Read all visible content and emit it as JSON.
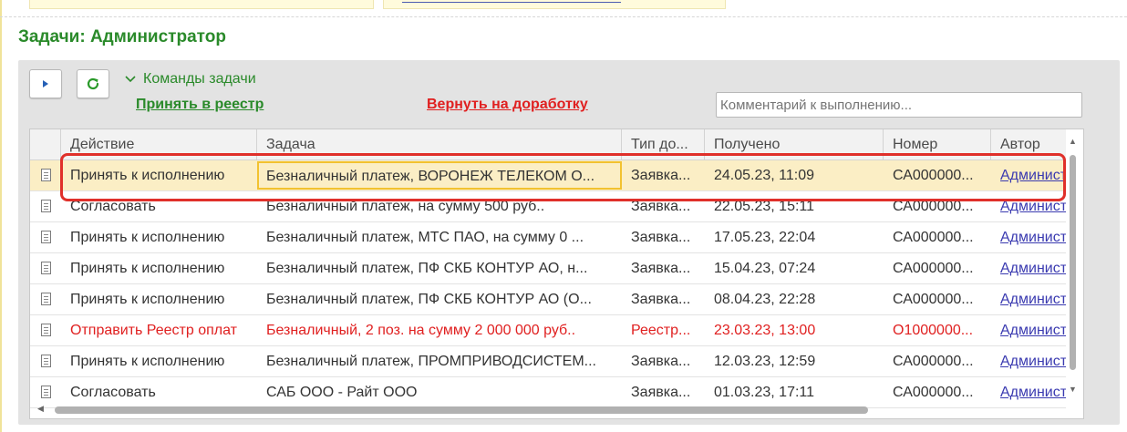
{
  "section_title": "Задачи: Администратор",
  "commands": {
    "toggle_label": "Команды задачи",
    "accept_label": "Принять в реестр",
    "return_label": "Вернуть на доработку",
    "comment_placeholder": "Комментарий к выполнению..."
  },
  "table": {
    "columns": [
      "Действие",
      "Задача",
      "Тип до...",
      "Получено",
      "Номер",
      "Автор"
    ],
    "rows": [
      {
        "action": "Принять к исполнению",
        "task": "Безналичный платеж, ВОРОНЕЖ ТЕЛЕКОМ О...",
        "type": "Заявка...",
        "received": "24.05.23, 11:09",
        "number": "СА000000...",
        "author": "Админист",
        "selected": true,
        "highlight": false
      },
      {
        "action": "Согласовать",
        "task": "Безналичный платеж,  на сумму 500 руб..",
        "type": "Заявка...",
        "received": "22.05.23, 15:11",
        "number": "СА000000...",
        "author": "Админист",
        "selected": false,
        "highlight": false
      },
      {
        "action": "Принять к исполнению",
        "task": "Безналичный платеж, МТС ПАО,  на сумму 0 ...",
        "type": "Заявка...",
        "received": "17.05.23, 22:04",
        "number": "СА000000...",
        "author": "Админист",
        "selected": false,
        "highlight": false
      },
      {
        "action": "Принять к исполнению",
        "task": "Безналичный платеж, ПФ СКБ КОНТУР АО,  н...",
        "type": "Заявка...",
        "received": "15.04.23, 07:24",
        "number": "СА000000...",
        "author": "Админист",
        "selected": false,
        "highlight": false
      },
      {
        "action": "Принять к исполнению",
        "task": "Безналичный платеж, ПФ СКБ КОНТУР АО (О...",
        "type": "Заявка...",
        "received": "08.04.23, 22:28",
        "number": "СА000000...",
        "author": "Админист",
        "selected": false,
        "highlight": false
      },
      {
        "action": "Отправить Реестр оплат",
        "task": "Безналичный, 2 поз. на сумму 2 000 000 руб..",
        "type": "Реестр...",
        "received": "23.03.23, 13:00",
        "number": "О1000000...",
        "author": "Админист",
        "selected": false,
        "highlight": true
      },
      {
        "action": "Принять к исполнению",
        "task": "Безналичный платеж, ПРОМПРИВОДСИСТЕМ...",
        "type": "Заявка...",
        "received": "12.03.23, 12:59",
        "number": "СА000000...",
        "author": "Админист",
        "selected": false,
        "highlight": false
      },
      {
        "action": "Согласовать",
        "task": "САБ ООО - Райт ООО",
        "type": "Заявка...",
        "received": "01.03.23, 17:11",
        "number": "СА000000...",
        "author": "Админист",
        "selected": false,
        "highlight": false
      }
    ]
  },
  "colors": {
    "accent_green": "#2a8a2a",
    "link_red": "#e02020",
    "selection_bg": "#fbeec5",
    "focus_border": "#f2c230",
    "annotation_frame": "#e0302a"
  },
  "icons": {
    "run": "play-icon",
    "refresh": "refresh-icon",
    "toggle": "chevron-down-icon",
    "row": "document-icon"
  }
}
